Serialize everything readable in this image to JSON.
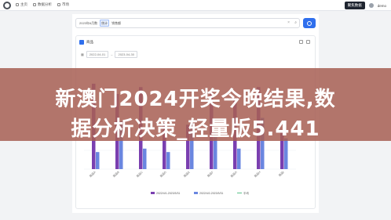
{
  "colors": {
    "bar_primary": "#7a3fb0",
    "bar_secondary": "#6a86e0",
    "accent": "#2f6fed",
    "banner": "#a85f54"
  },
  "topbar": {
    "nav": [
      {
        "label": "主页",
        "icon": "home-icon"
      },
      {
        "label": "数据分析",
        "icon": "chart-icon"
      },
      {
        "label": "市场",
        "icon": "market-icon"
      }
    ],
    "action_button": "聚焦数据",
    "user_name": "demo"
  },
  "search": {
    "chips": [
      "2023年6月数",
      "统计",
      "销售额"
    ]
  },
  "card": {
    "title": "商品",
    "date_start": "2022-04-01",
    "date_end": "2023-04-30"
  },
  "chart_data": {
    "type": "bar",
    "categories": [
      "商品A",
      "商品B",
      "商品C",
      "商品D",
      "商品E",
      "商品F",
      "商品G",
      "商品H",
      "商品I"
    ],
    "series": [
      {
        "name": "2022/4/1-2023/3/31",
        "values": [
          100,
          88,
          96,
          54,
          52,
          92,
          82,
          96,
          46
        ]
      },
      {
        "name": "2022/4/2-2023/3/31",
        "values": [
          20,
          56,
          24,
          20,
          54,
          44,
          24,
          60,
          36
        ]
      }
    ],
    "legend_extra": "平均"
  },
  "banner": {
    "line1": "新澳门2024开奖今晚结果,数",
    "line2": "据分析决策_轻量版5.441"
  }
}
